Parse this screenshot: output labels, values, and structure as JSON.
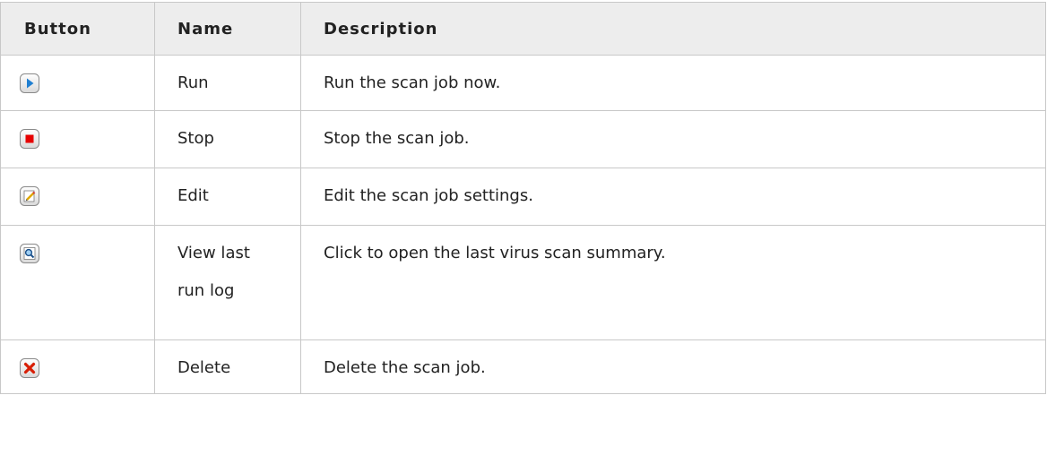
{
  "table": {
    "headers": {
      "button": "Button",
      "name": "Name",
      "description": "Description"
    },
    "rows": [
      {
        "icon": "play-icon",
        "name": "Run",
        "description": "Run the scan job now."
      },
      {
        "icon": "stop-icon",
        "name": "Stop",
        "description": "Stop the scan job."
      },
      {
        "icon": "edit-icon",
        "name": "Edit",
        "description": "Edit the scan job settings."
      },
      {
        "icon": "view-log-icon",
        "name": "View last run log",
        "description": "Click to open the last virus scan summary."
      },
      {
        "icon": "delete-icon",
        "name": "Delete",
        "description": "Delete the scan job."
      }
    ]
  },
  "colors": {
    "header_bg": "#ededed",
    "border": "#c8c8c8",
    "play_blue": "#1f7fd1",
    "stop_red": "#e60000",
    "delete_red": "#d81e05"
  }
}
